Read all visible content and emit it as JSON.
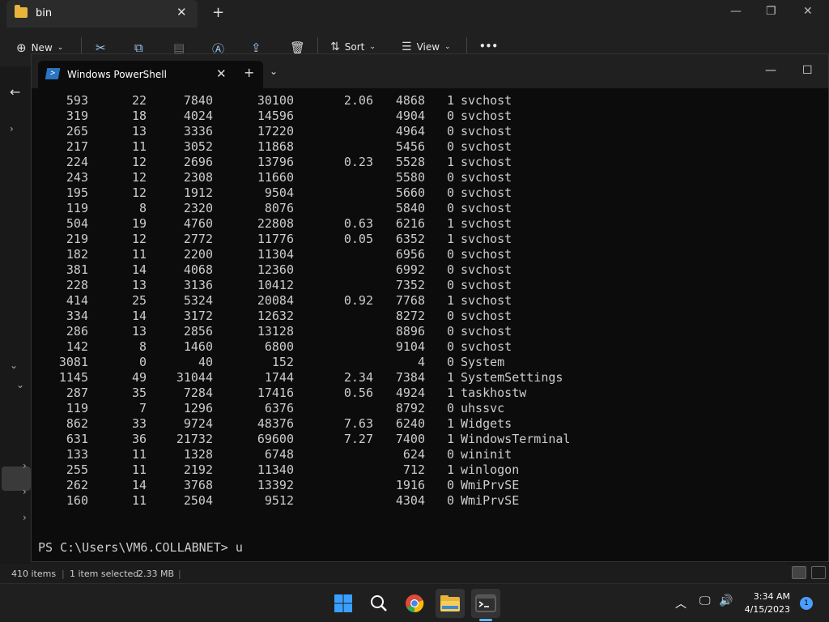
{
  "explorer": {
    "tab_title": "bin",
    "toolbar": {
      "new_label": "New",
      "sort_label": "Sort",
      "view_label": "View",
      "more_label": "•••"
    },
    "status": {
      "items": "410 items",
      "selected": "1 item selected",
      "size": "2.33 MB"
    }
  },
  "terminal": {
    "tab_title": "Windows PowerShell",
    "rows": [
      [
        "593",
        "22",
        "7840",
        "30100",
        "2.06",
        "4868",
        "1",
        "svchost"
      ],
      [
        "319",
        "18",
        "4024",
        "14596",
        "",
        "4904",
        "0",
        "svchost"
      ],
      [
        "265",
        "13",
        "3336",
        "17220",
        "",
        "4964",
        "0",
        "svchost"
      ],
      [
        "217",
        "11",
        "3052",
        "11868",
        "",
        "5456",
        "0",
        "svchost"
      ],
      [
        "224",
        "12",
        "2696",
        "13796",
        "0.23",
        "5528",
        "1",
        "svchost"
      ],
      [
        "243",
        "12",
        "2308",
        "11660",
        "",
        "5580",
        "0",
        "svchost"
      ],
      [
        "195",
        "12",
        "1912",
        "9504",
        "",
        "5660",
        "0",
        "svchost"
      ],
      [
        "119",
        "8",
        "2320",
        "8076",
        "",
        "5840",
        "0",
        "svchost"
      ],
      [
        "504",
        "19",
        "4760",
        "22808",
        "0.63",
        "6216",
        "1",
        "svchost"
      ],
      [
        "219",
        "12",
        "2772",
        "11776",
        "0.05",
        "6352",
        "1",
        "svchost"
      ],
      [
        "182",
        "11",
        "2200",
        "11304",
        "",
        "6956",
        "0",
        "svchost"
      ],
      [
        "381",
        "14",
        "4068",
        "12360",
        "",
        "6992",
        "0",
        "svchost"
      ],
      [
        "228",
        "13",
        "3136",
        "10412",
        "",
        "7352",
        "0",
        "svchost"
      ],
      [
        "414",
        "25",
        "5324",
        "20084",
        "0.92",
        "7768",
        "1",
        "svchost"
      ],
      [
        "334",
        "14",
        "3172",
        "12632",
        "",
        "8272",
        "0",
        "svchost"
      ],
      [
        "286",
        "13",
        "2856",
        "13128",
        "",
        "8896",
        "0",
        "svchost"
      ],
      [
        "142",
        "8",
        "1460",
        "6800",
        "",
        "9104",
        "0",
        "svchost"
      ],
      [
        "3081",
        "0",
        "40",
        "152",
        "",
        "4",
        "0",
        "System"
      ],
      [
        "1145",
        "49",
        "31044",
        "1744",
        "2.34",
        "7384",
        "1",
        "SystemSettings"
      ],
      [
        "287",
        "35",
        "7284",
        "17416",
        "0.56",
        "4924",
        "1",
        "taskhostw"
      ],
      [
        "119",
        "7",
        "1296",
        "6376",
        "",
        "8792",
        "0",
        "uhssvc"
      ],
      [
        "862",
        "33",
        "9724",
        "48376",
        "7.63",
        "6240",
        "1",
        "Widgets"
      ],
      [
        "631",
        "36",
        "21732",
        "69600",
        "7.27",
        "7400",
        "1",
        "WindowsTerminal"
      ],
      [
        "133",
        "11",
        "1328",
        "6748",
        "",
        "624",
        "0",
        "wininit"
      ],
      [
        "255",
        "11",
        "2192",
        "11340",
        "",
        "712",
        "1",
        "winlogon"
      ],
      [
        "262",
        "14",
        "3768",
        "13392",
        "",
        "1916",
        "0",
        "WmiPrvSE"
      ],
      [
        "160",
        "11",
        "2504",
        "9512",
        "",
        "4304",
        "0",
        "WmiPrvSE"
      ]
    ],
    "prompt": "PS C:\\Users\\VM6.COLLABNET> u"
  },
  "taskbar": {
    "time": "3:34 AM",
    "date": "4/15/2023",
    "notification_count": "1"
  }
}
